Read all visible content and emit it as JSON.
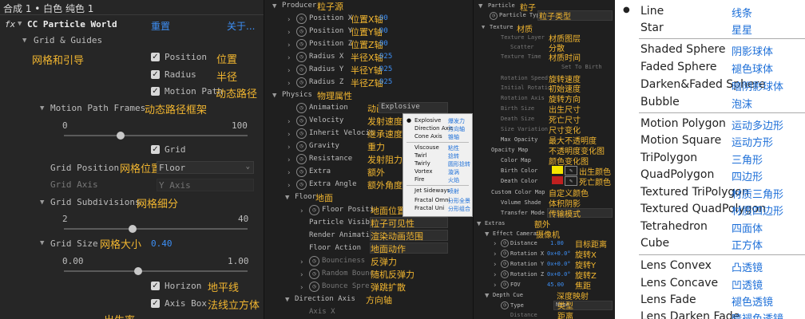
{
  "panel1": {
    "tab_title": "合成 1 • 白色 纯色 1",
    "fx_label": "fx",
    "effect_name": "CC Particle World",
    "reset": "重置",
    "about": "关于...",
    "grid_guides": "Grid & Guides",
    "grid_guides_zh": "网格和引导",
    "position": "Position",
    "position_zh": "位置",
    "radius": "Radius",
    "radius_zh": "半径",
    "motion_path": "Motion Path",
    "motion_path_zh": "动态路径",
    "motion_path_frames": "Motion Path Frames",
    "motion_path_frames_zh": "动态路径框架",
    "slider1_min": "0",
    "slider1_max": "100",
    "grid": "Grid",
    "grid_position": "Grid Position",
    "grid_position_zh": "网格位置",
    "grid_position_value": "Floor",
    "grid_axis": "Grid Axis",
    "grid_axis_value": "Y Axis",
    "grid_subdivisions": "Grid Subdivisions",
    "grid_subdivisions_zh": "网格细分",
    "slider2_min": "2",
    "slider2_max": "40",
    "grid_size": "Grid Size",
    "grid_size_zh": "网格大小",
    "grid_size_value": "0.40",
    "slider3_min": "0.00",
    "slider3_max": "1.00",
    "horizon": "Horizon",
    "horizon_zh": "地平线",
    "axis_box": "Axis Box",
    "axis_box_zh": "法线立方体",
    "birth_rate_zh": "出生率"
  },
  "panel2": {
    "producer": "Producer",
    "producer_zh": "粒子源",
    "rows": [
      {
        "label": "Position X",
        "zh": "位置X轴",
        "value": "00"
      },
      {
        "label": "Position Y",
        "zh": "位置Y轴",
        "value": "00"
      },
      {
        "label": "Position Z",
        "zh": "位置Z轴",
        "value": "00"
      },
      {
        "label": "Radius X",
        "zh": "半径X轴",
        "value": "025"
      },
      {
        "label": "Radius Y",
        "zh": "半径Y轴",
        "value": "025"
      },
      {
        "label": "Radius Z",
        "zh": "半径Z轴",
        "value": "025"
      }
    ],
    "physics": "Physics",
    "physics_zh": "物理属性",
    "physics_rows": [
      {
        "label": "Animation",
        "zh": "动画",
        "value": "Explosive"
      },
      {
        "label": "Velocity",
        "zh": "发射速度"
      },
      {
        "label": "Inherit Velocit",
        "zh": "继承速度"
      },
      {
        "label": "Gravity",
        "zh": "重力"
      },
      {
        "label": "Resistance",
        "zh": "发射阻力"
      },
      {
        "label": "Extra",
        "zh": "额外"
      },
      {
        "label": "Extra Angle",
        "zh": "额外角度"
      }
    ],
    "floor": "Floor",
    "floor_zh": "地面",
    "floor_rows": [
      {
        "label": "Floor Positi",
        "zh": "地面位置"
      },
      {
        "label": "Particle Visibi",
        "zh": "粒子可见性"
      },
      {
        "label": "Render Animatio",
        "zh": "渲染动画范围"
      },
      {
        "label": "Floor Action",
        "zh": "地面动作"
      },
      {
        "label": "Bounciness",
        "zh": "反弹力"
      },
      {
        "label": "Random Bounc",
        "zh": "随机反弹力"
      },
      {
        "label": "Bounce Spre",
        "zh": "弹跳扩散"
      }
    ],
    "direction_axis": "Direction Axis",
    "direction_axis_zh": "方向轴",
    "axis_x": "Axis X"
  },
  "animation_menu": {
    "items": [
      {
        "en": "Explosive",
        "zh": "爆发力",
        "selected": true
      },
      {
        "en": "Direction Axis",
        "zh": "方向轴"
      },
      {
        "en": "Cone Axis",
        "zh": "锥轴"
      },
      {
        "en": "Viscouse",
        "zh": "粘性"
      },
      {
        "en": "Twirl",
        "zh": "捻转"
      },
      {
        "en": "Twirly",
        "zh": "圆形捻转"
      },
      {
        "en": "Vortex",
        "zh": "漩涡"
      },
      {
        "en": "Fire",
        "zh": "火焰"
      },
      {
        "en": "Jet Sideways",
        "zh": "喷射"
      },
      {
        "en": "Fractal Omni",
        "zh": "分形全景"
      },
      {
        "en": "Fractal Uni",
        "zh": "分形组合"
      }
    ]
  },
  "panel3": {
    "particle": "Particle",
    "particle_zh": "粒子",
    "rows": [
      {
        "label": "Particle Type",
        "zh": "粒子类型"
      },
      {
        "label": "Texture",
        "zh": "材质"
      },
      {
        "label": "Texture Layer",
        "zh": "材质图层"
      },
      {
        "label": "Scatter",
        "zh": "分散"
      },
      {
        "label": "Texture Time",
        "zh": "材质时间"
      },
      {
        "label": "",
        "extra": "Set To Birth"
      },
      {
        "label": "Rotation Speed",
        "zh": "旋转速度"
      },
      {
        "label": "Initial Rotatio",
        "zh": "初始速度"
      },
      {
        "label": "Rotation Axis",
        "zh": "旋转方向"
      },
      {
        "label": "Birth Size",
        "zh": "出生尺寸"
      },
      {
        "label": "Death Size",
        "zh": "死亡尺寸"
      },
      {
        "label": "Size Variation",
        "zh": "尺寸变化"
      },
      {
        "label": "Max Opacity",
        "zh": "最大不透明度"
      },
      {
        "label": "Opacity Map",
        "zh": "不透明度变化图"
      },
      {
        "label": "Color Map",
        "zh": "颜色变化图"
      },
      {
        "label": "Birth Color",
        "zh": "出生颜色"
      },
      {
        "label": "Death Color",
        "zh": "死亡颜色"
      },
      {
        "label": "Custom Color Map",
        "zh": "自定义颜色"
      },
      {
        "label": "Volume Shade",
        "zh": "体积阴影"
      },
      {
        "label": "Transfer Mode",
        "zh": "传输模式"
      }
    ],
    "extras": "Extras",
    "extras_zh": "额外",
    "effect_camera": "Effect Camera",
    "effect_camera_zh": "摄像机",
    "cam_rows": [
      {
        "label": "Distance",
        "value": "1.00",
        "zh": "目标距离"
      },
      {
        "label": "Rotation X",
        "value": "0x+0.0°",
        "zh": "旋转X"
      },
      {
        "label": "Rotation Y",
        "value": "0x+0.0°",
        "zh": "旋转Y"
      },
      {
        "label": "Rotation Z",
        "value": "0x+0.0°",
        "zh": "旋转Z"
      },
      {
        "label": "FOV",
        "value": "45.00",
        "zh": "焦距"
      }
    ],
    "depth_cue": "Depth Cue",
    "depth_cue_zh": "深度映射",
    "type": "Type",
    "type_zh": "类型",
    "type_value": "None",
    "distance": "Distance",
    "distance_zh": "距离",
    "colors": {
      "birth": "#f5e400",
      "death": "#c0201f"
    }
  },
  "panel4": {
    "items": [
      {
        "en": "Line",
        "zh": "线条",
        "selected": true
      },
      {
        "en": "Star",
        "zh": "星星"
      },
      {
        "en": "Shaded Sphere",
        "zh": "阴影球体"
      },
      {
        "en": "Faded Sphere",
        "zh": "褪色球体"
      },
      {
        "en": "Darken&Faded Sphere",
        "zh": "暗阴影球体"
      },
      {
        "en": "Bubble",
        "zh": "泡沫"
      },
      {
        "en": "Motion Polygon",
        "zh": "运动多边形"
      },
      {
        "en": "Motion Square",
        "zh": "运动方形"
      },
      {
        "en": "TriPolygon",
        "zh": "三角形"
      },
      {
        "en": "QuadPolygon",
        "zh": "四边形"
      },
      {
        "en": "Textured TriPolygon",
        "zh": "材质三角形"
      },
      {
        "en": "Textured QuadPolygon",
        "zh": "材质四边形"
      },
      {
        "en": "Tetrahedron",
        "zh": "四面体"
      },
      {
        "en": "Cube",
        "zh": "正方体"
      },
      {
        "en": "Lens Convex",
        "zh": "凸透镜"
      },
      {
        "en": "Lens Concave",
        "zh": "凹透镜"
      },
      {
        "en": "Lens Fade",
        "zh": "褪色透镜"
      },
      {
        "en": "Lens Darken Fade",
        "zh": "暗褪色透镜"
      }
    ]
  }
}
